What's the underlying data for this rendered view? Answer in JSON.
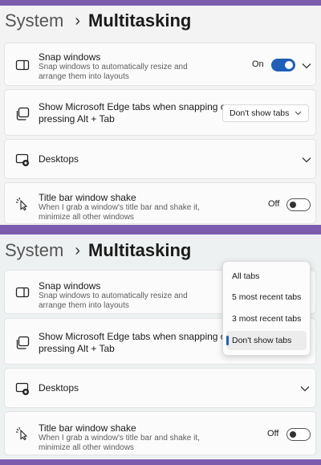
{
  "header": {
    "section": "System",
    "separator": "›",
    "page": "Multitasking"
  },
  "settings": {
    "snap": {
      "title": "Snap windows",
      "desc_line1": "Snap windows to automatically resize and",
      "desc_line2": "arrange them into layouts",
      "state_label": "On",
      "toggle_on": true
    },
    "edge_tabs": {
      "title_line1": "Show Microsoft Edge tabs when snapping or",
      "title_line2": "pressing Alt + Tab",
      "selected": "Don't show tabs"
    },
    "desktops": {
      "title": "Desktops"
    },
    "shake": {
      "title": "Title bar window shake",
      "desc_line1": "When I grab a window's title bar and shake it,",
      "desc_line2": "minimize all other windows",
      "state_label": "Off",
      "toggle_on": false
    }
  },
  "dropdown": {
    "options": [
      "All tabs",
      "5 most recent tabs",
      "3 most recent tabs",
      "Don't show tabs"
    ],
    "selected_index": 3
  },
  "colors": {
    "accent": "#1f5fb8",
    "frame": "#7b5cae"
  },
  "icons": [
    "snap-windows-icon",
    "edge-tabs-icon",
    "desktops-icon",
    "window-shake-icon",
    "chevron-down-icon"
  ]
}
